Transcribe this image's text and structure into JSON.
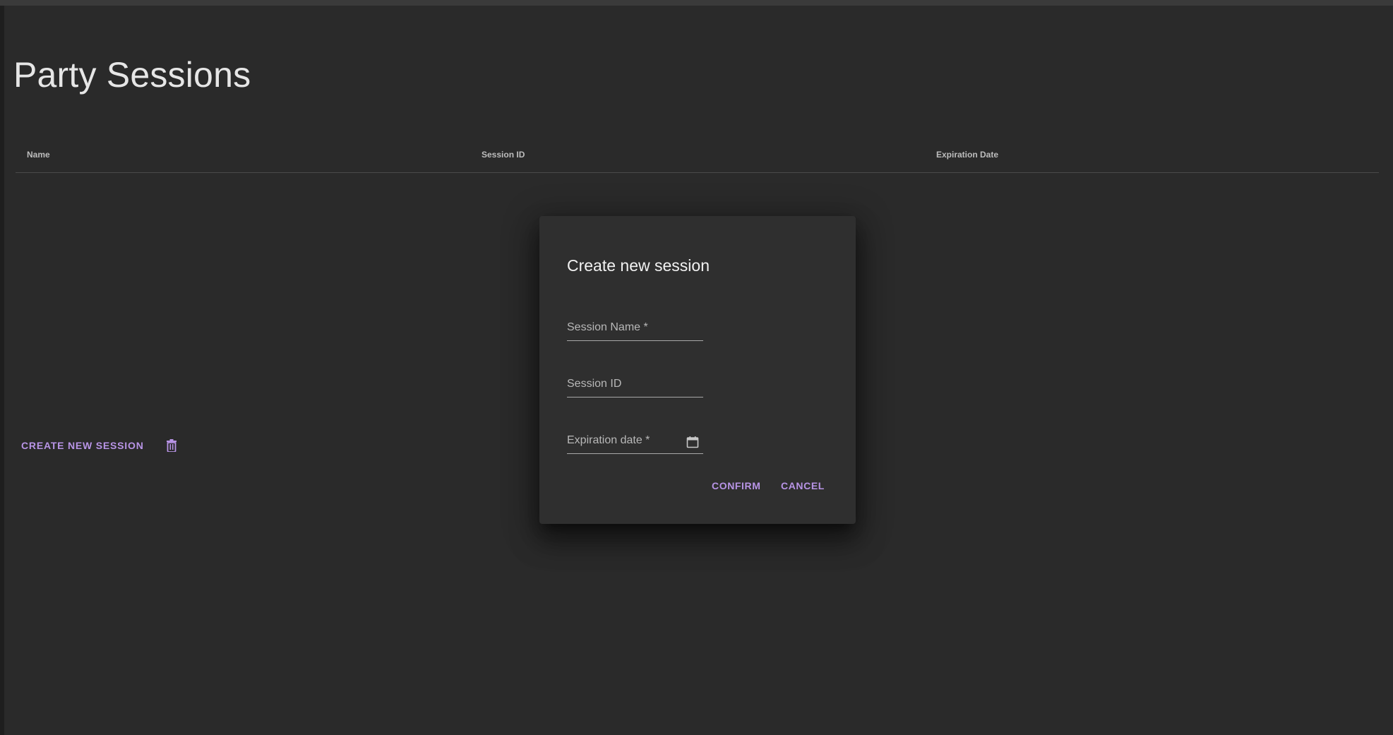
{
  "page": {
    "title": "Party Sessions"
  },
  "table": {
    "columns": [
      "Name",
      "Session ID",
      "Expiration Date"
    ],
    "rows": []
  },
  "actions": {
    "create_label": "CREATE NEW SESSION",
    "delete_icon": "trash-icon"
  },
  "dialog": {
    "title": "Create new session",
    "fields": {
      "session_name": {
        "label": "Session Name *",
        "value": ""
      },
      "session_id": {
        "label": "Session ID",
        "value": ""
      },
      "expiration_date": {
        "label": "Expiration date *",
        "value": "",
        "icon": "calendar-icon"
      }
    },
    "confirm_label": "CONFIRM",
    "cancel_label": "CANCEL"
  },
  "colors": {
    "background": "#2a2a2a",
    "dialog": "#2f2f2f",
    "accent": "#b894e6"
  }
}
